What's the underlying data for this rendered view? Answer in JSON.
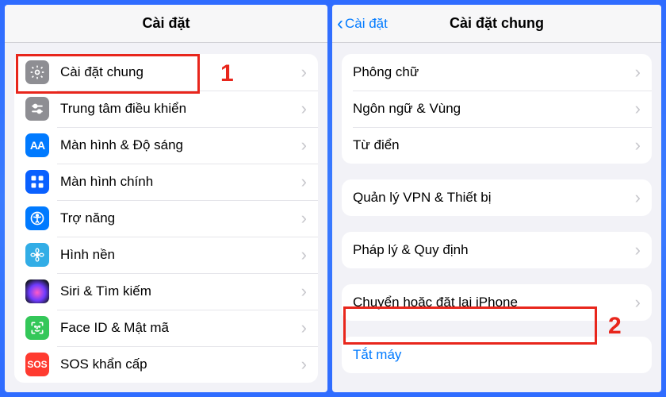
{
  "left": {
    "title": "Cài đặt",
    "rows": [
      {
        "key": "general",
        "label": "Cài đặt chung",
        "icon": "gear-icon"
      },
      {
        "key": "control-center",
        "label": "Trung tâm điều khiển",
        "icon": "sliders-icon"
      },
      {
        "key": "display",
        "label": "Màn hình & Độ sáng",
        "icon": "text-size-icon"
      },
      {
        "key": "home-screen",
        "label": "Màn hình chính",
        "icon": "grid-icon"
      },
      {
        "key": "accessibility",
        "label": "Trợ năng",
        "icon": "accessibility-icon"
      },
      {
        "key": "wallpaper",
        "label": "Hình nền",
        "icon": "flower-icon"
      },
      {
        "key": "siri",
        "label": "Siri & Tìm kiếm",
        "icon": "siri-icon"
      },
      {
        "key": "faceid",
        "label": "Face ID & Mật mã",
        "icon": "faceid-icon"
      },
      {
        "key": "sos",
        "label": "SOS khẩn cấp",
        "icon": "sos-icon"
      }
    ],
    "annotation_number": "1"
  },
  "right": {
    "back_label": "Cài đặt",
    "title": "Cài đặt chung",
    "groups": [
      {
        "rows": [
          {
            "key": "fonts",
            "label": "Phông chữ"
          },
          {
            "key": "language",
            "label": "Ngôn ngữ & Vùng"
          },
          {
            "key": "dictionary",
            "label": "Từ điển"
          }
        ]
      },
      {
        "rows": [
          {
            "key": "vpn",
            "label": "Quản lý VPN & Thiết bị"
          }
        ]
      },
      {
        "rows": [
          {
            "key": "legal",
            "label": "Pháp lý & Quy định"
          }
        ]
      },
      {
        "rows": [
          {
            "key": "transfer-reset",
            "label": "Chuyển hoặc đặt lại iPhone"
          }
        ]
      },
      {
        "rows": [
          {
            "key": "shutdown",
            "label": "Tắt máy",
            "is_link": true,
            "no_chevron": true
          }
        ]
      }
    ],
    "annotation_number": "2"
  },
  "icons": {
    "gear-icon": {
      "cls": "ic-gray",
      "svg": "gear"
    },
    "sliders-icon": {
      "cls": "ic-gray",
      "svg": "sliders"
    },
    "text-size-icon": {
      "cls": "ic-blue",
      "svg": "aa"
    },
    "grid-icon": {
      "cls": "ic-darkblue",
      "svg": "grid"
    },
    "accessibility-icon": {
      "cls": "ic-blue",
      "svg": "access"
    },
    "flower-icon": {
      "cls": "ic-cyan",
      "svg": "flower"
    },
    "siri-icon": {
      "cls": "ic-siri",
      "svg": ""
    },
    "faceid-icon": {
      "cls": "ic-green",
      "svg": "faceid"
    },
    "sos-icon": {
      "cls": "ic-red",
      "svg": "sos"
    }
  }
}
